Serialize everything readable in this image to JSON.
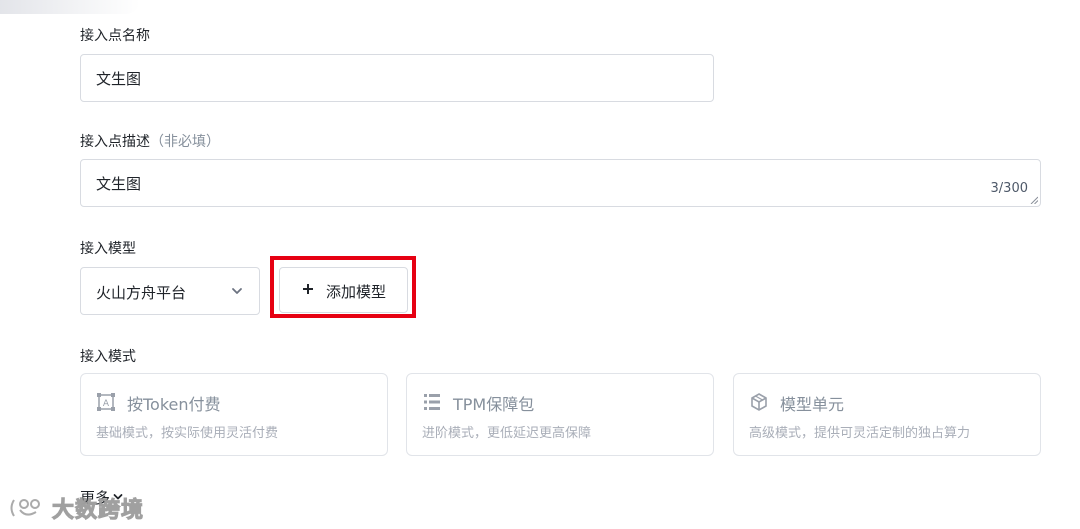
{
  "form": {
    "name_label": "接入点名称",
    "name_value": "文生图",
    "desc_label": "接入点描述",
    "desc_hint": "（非必填）",
    "desc_value": "文生图",
    "desc_counter": "3/300",
    "model_label": "接入模型",
    "model_select_value": "火山方舟平台",
    "add_model_label": "添加模型",
    "mode_label": "接入模式",
    "modes": [
      {
        "title": "按Token付费",
        "desc": "基础模式，按实际使用灵活付费",
        "icon": "token-icon"
      },
      {
        "title": "TPM保障包",
        "desc": "进阶模式，更低延迟更高保障",
        "icon": "tpm-icon"
      },
      {
        "title": "模型单元",
        "desc": "高级模式，提供可灵活定制的独占算力",
        "icon": "model-unit-icon"
      }
    ],
    "more_label": "更多"
  },
  "watermark": {
    "text": "大数跨境"
  },
  "colors": {
    "highlight": "#e60012",
    "muted": "#86909c",
    "border": "#d8dbe1"
  }
}
